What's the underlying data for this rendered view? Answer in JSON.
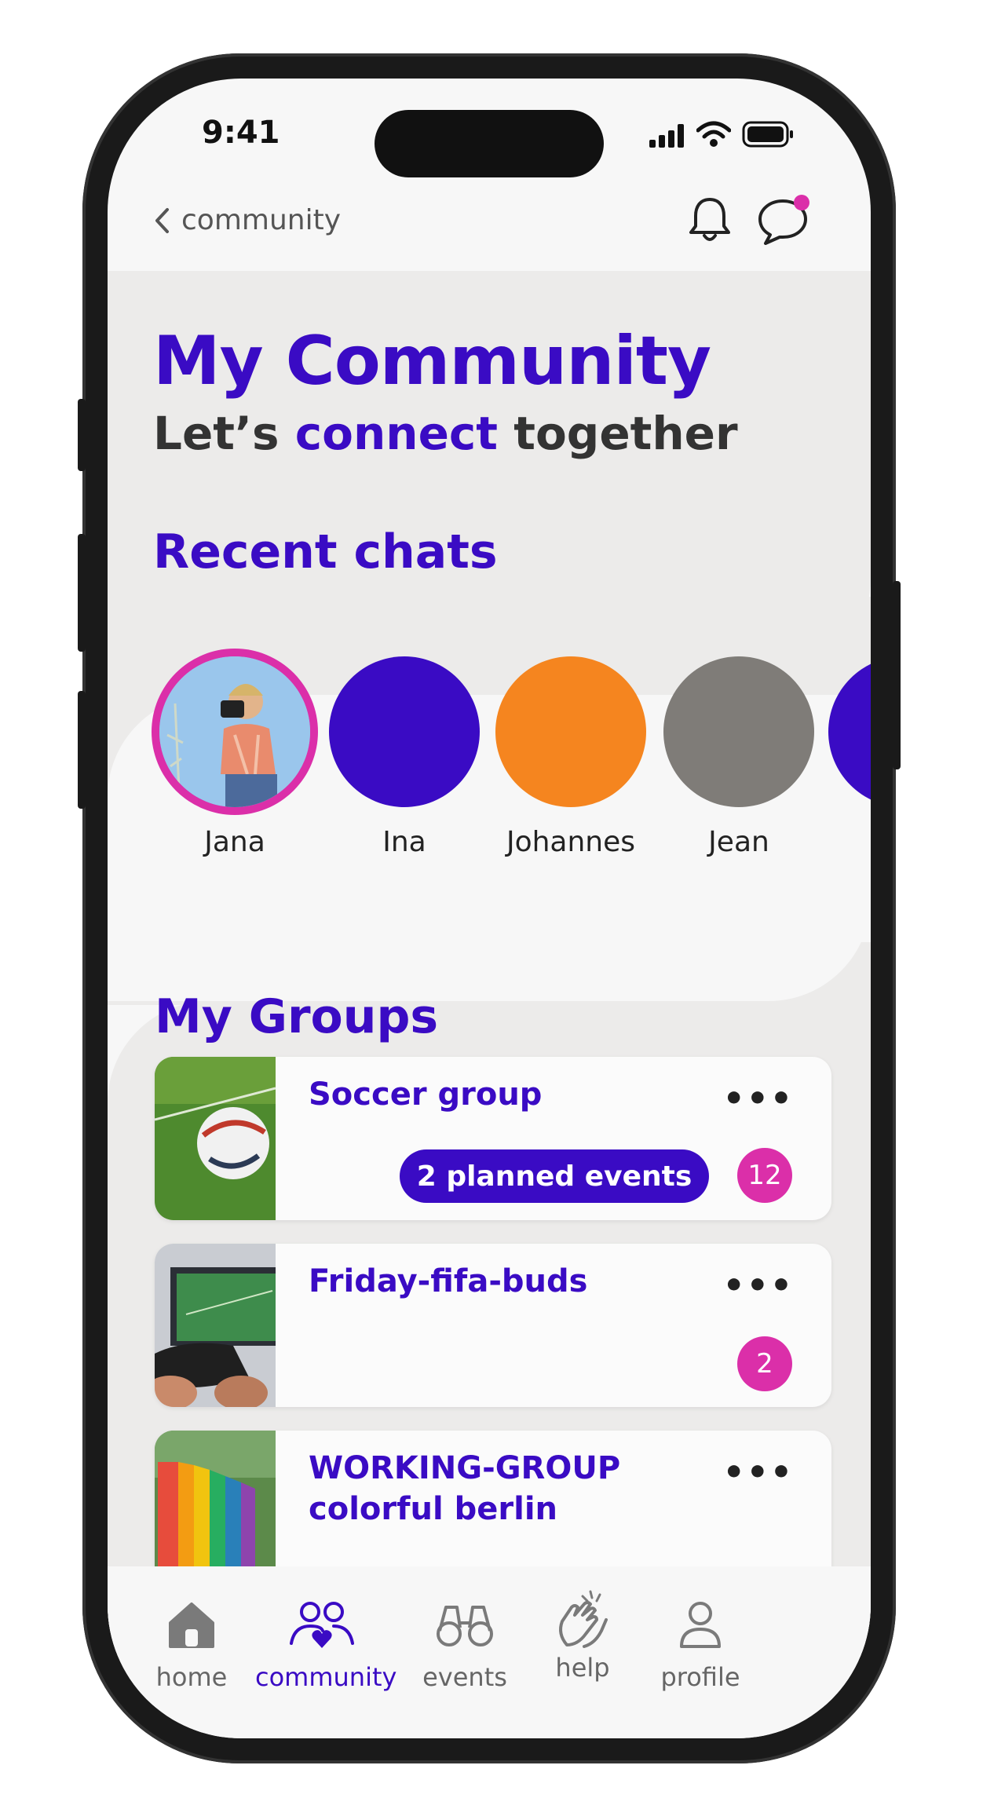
{
  "status_bar": {
    "time": "9:41"
  },
  "nav": {
    "back_label": "community"
  },
  "header": {
    "title": "My Community",
    "subtitle_prefix": "Let’s ",
    "subtitle_accent": "connect",
    "subtitle_suffix": " together"
  },
  "recent_chats": {
    "title": "Recent chats",
    "contacts": [
      {
        "name": "Jana",
        "color": "#6aa7d8"
      },
      {
        "name": "Ina",
        "color": "#3a0bc4"
      },
      {
        "name": "Johannes",
        "color": "#f5851f"
      },
      {
        "name": "Jean",
        "color": "#7f7c78"
      }
    ]
  },
  "groups": {
    "title": "My Groups",
    "items": [
      {
        "name": "Soccer group",
        "events_label": "2 planned events",
        "count": "12"
      },
      {
        "name": "Friday-fifa-buds",
        "count": "2"
      },
      {
        "name_line1": "WORKING-GROUP",
        "name_line2": "colorful berlin"
      }
    ]
  },
  "tabs": [
    {
      "label": "home"
    },
    {
      "label": "community"
    },
    {
      "label": "events"
    },
    {
      "label": "help"
    },
    {
      "label": "profile"
    }
  ],
  "colors": {
    "brand": "#3a0bc4",
    "accent_pink": "#db2fa9",
    "orange": "#f5851f"
  }
}
